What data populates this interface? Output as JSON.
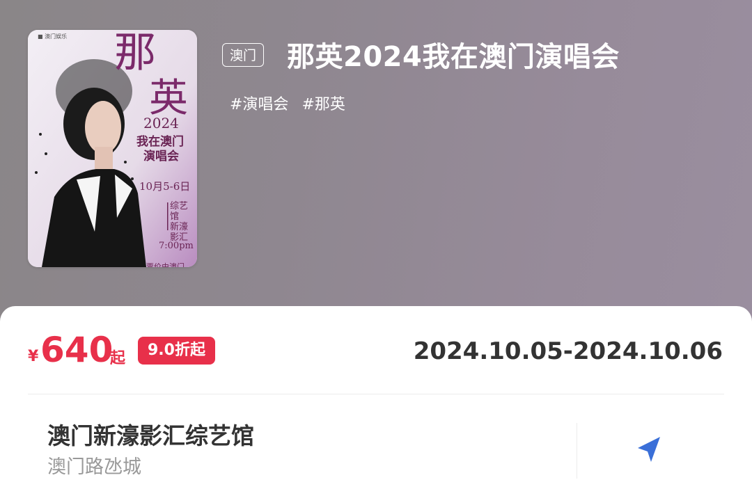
{
  "poster": {
    "logo_text": "■ 澳门娱乐",
    "name_line1": "那",
    "name_line2": "英",
    "year": "2024",
    "subtitle_line1": "我在澳门",
    "subtitle_line2": "演唱会",
    "date": "10月5-6日",
    "venue": "综艺馆 新濠影汇",
    "time": "7:00pm",
    "footer": "票价由澳门"
  },
  "event": {
    "region_tag": "澳门",
    "title": "那英2024我在澳门演唱会",
    "tags": [
      "#演唱会",
      "#那英"
    ]
  },
  "price": {
    "currency": "¥",
    "value": "640",
    "suffix": "起",
    "discount": "9.0折起"
  },
  "date_range": "2024.10.05-2024.10.06",
  "venue": {
    "name": "澳门新濠影汇综艺馆",
    "address": "澳门路氹城"
  },
  "colors": {
    "accent": "#e8304a",
    "nav_icon": "#3a6fd8"
  },
  "icons": {
    "navigate": "navigation-arrow-icon"
  }
}
